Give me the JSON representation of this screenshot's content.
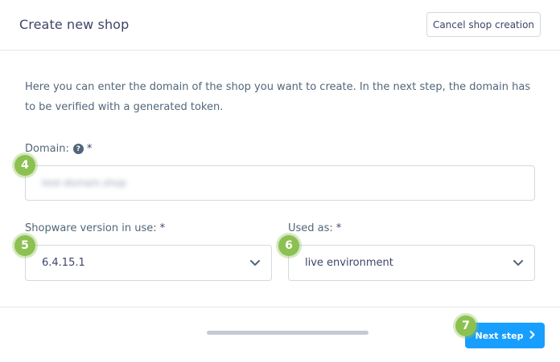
{
  "header": {
    "title": "Create new shop",
    "cancel_label": "Cancel shop creation"
  },
  "intro_text": "Here you can enter the domain of the shop you want to create. In the next step, the domain has to be verified with a generated token.",
  "form": {
    "domain": {
      "label": "Domain:",
      "required_mark": "*",
      "help_icon": "?",
      "value": "test-domain.shop",
      "value_blurred": true
    },
    "version": {
      "label": "Shopware version in use:",
      "required_mark": "*",
      "selected": "6.4.15.1"
    },
    "used_as": {
      "label": "Used as:",
      "required_mark": "*",
      "selected": "live environment"
    }
  },
  "markers": [
    "4",
    "5",
    "6",
    "7"
  ],
  "footer": {
    "next_label": "Next step"
  },
  "colors": {
    "accent": "#189eff",
    "marker": "#8cc152",
    "text": "#3d4566",
    "border": "#d1d9e0"
  }
}
